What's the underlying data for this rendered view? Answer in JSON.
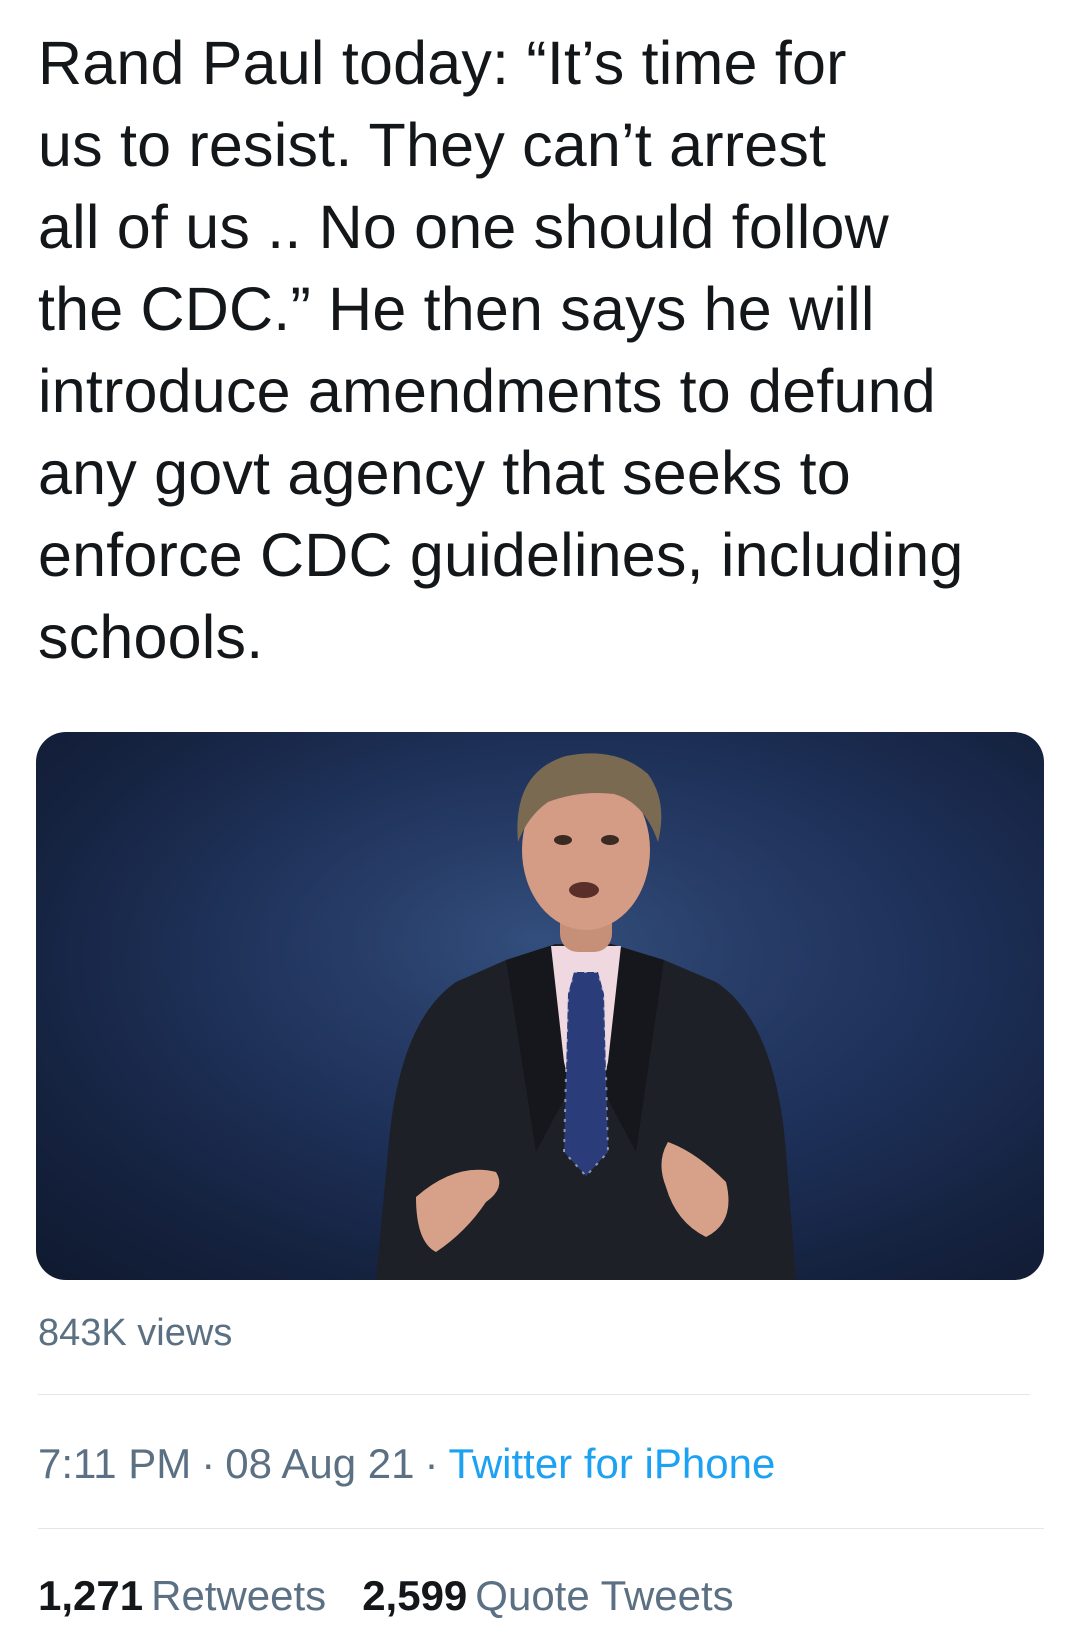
{
  "tweet": {
    "text": "Rand Paul today: “It’s time for\nus to resist. They can’t arrest\nall of us .. No one should follow\nthe CDC.” He then says he will\nintroduce amendments to defund\nany govt agency that seeks to\nenforce CDC guidelines, including\nschools."
  },
  "media": {
    "type": "video",
    "views": "843K views"
  },
  "meta": {
    "time": "7:11 PM",
    "separator": "·",
    "date": "08 Aug 21",
    "source": "Twitter for iPhone"
  },
  "stats": {
    "retweets_count": "1,271",
    "retweets_label": "Retweets",
    "quote_count": "2,599",
    "quote_label": "Quote Tweets"
  },
  "colors": {
    "text": "#14171a",
    "secondary": "#5b7083",
    "link": "#1da1f2",
    "divider": "#e1e8ed"
  }
}
